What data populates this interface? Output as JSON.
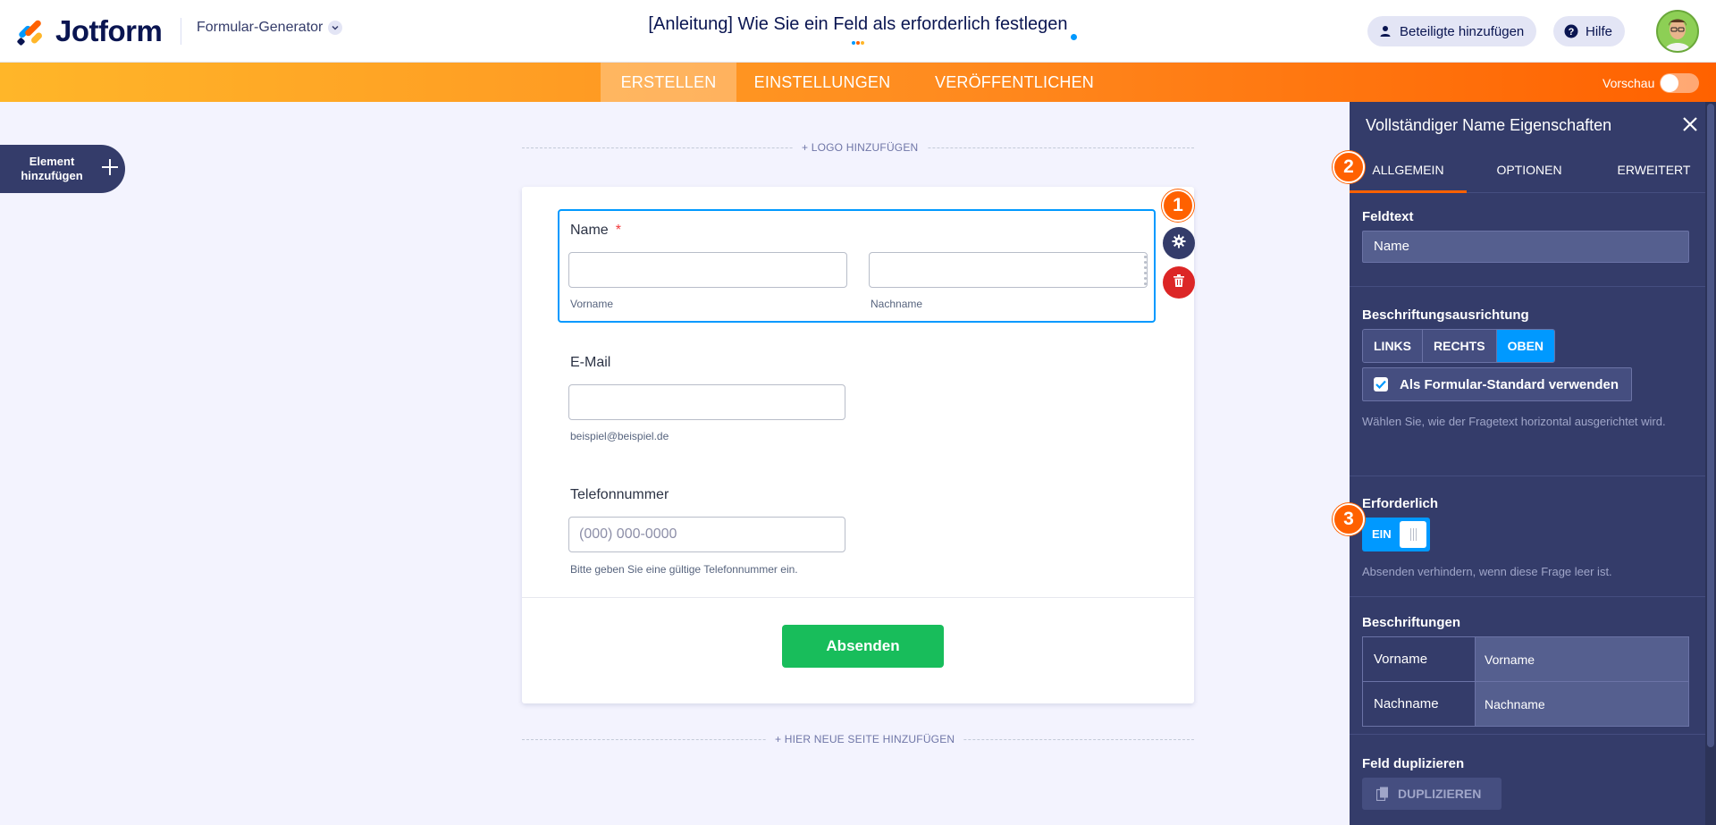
{
  "header": {
    "logo_text": "Jotform",
    "builder_label": "Formular-Generator",
    "form_title": "[Anleitung] Wie Sie ein Feld als erforderlich festlegen",
    "add_participants_label": "Beteiligte hinzufügen",
    "help_label": "Hilfe"
  },
  "nav": {
    "tabs": [
      {
        "label": "ERSTELLEN",
        "active": true
      },
      {
        "label": "EINSTELLUNGEN",
        "active": false
      },
      {
        "label": "VERÖFFENTLICHEN",
        "active": false
      }
    ],
    "preview_label": "Vorschau",
    "preview_on": false
  },
  "canvas": {
    "add_element_label": "Element hinzufügen",
    "add_logo_label": "+ LOGO HINZUFÜGEN",
    "add_page_label": "+ HIER NEUE SEITE HINZUFÜGEN",
    "fields": {
      "name": {
        "label": "Name",
        "required_mark": "*",
        "first_sublabel": "Vorname",
        "last_sublabel": "Nachname",
        "first_value": "",
        "last_value": ""
      },
      "email": {
        "label": "E-Mail",
        "value": "",
        "sublabel": "beispiel@beispiel.de"
      },
      "phone": {
        "label": "Telefonnummer",
        "placeholder": "(000) 000-0000",
        "sublabel": "Bitte geben Sie eine gültige Telefonnummer ein."
      }
    },
    "submit_label": "Absenden",
    "step_badges": [
      "1",
      "2",
      "3"
    ]
  },
  "panel": {
    "title": "Vollständiger Name Eigenschaften",
    "tabs": [
      {
        "label": "ALLGEMEIN",
        "active": true
      },
      {
        "label": "OPTIONEN",
        "active": false
      },
      {
        "label": "ERWEITERT",
        "active": false
      }
    ],
    "field_text_label": "Feldtext",
    "field_text_value": "Name",
    "alignment_label": "Beschriftungsausrichtung",
    "alignment_options": [
      {
        "label": "LINKS",
        "selected": false
      },
      {
        "label": "RECHTS",
        "selected": false
      },
      {
        "label": "OBEN",
        "selected": true
      }
    ],
    "default_checkbox_label": "Als Formular-Standard verwenden",
    "default_checked": true,
    "alignment_hint": "Wählen Sie, wie der Fragetext horizontal ausgerichtet wird.",
    "required_label": "Erforderlich",
    "required_toggle_label": "EIN",
    "required_on": true,
    "required_hint": "Absenden verhindern, wenn diese Frage leer ist.",
    "captions_label": "Beschriftungen",
    "captions": [
      {
        "key": "Vorname",
        "value": "Vorname"
      },
      {
        "key": "Nachname",
        "value": "Nachname"
      }
    ],
    "duplicate_label": "Feld duplizieren",
    "duplicate_button_label": "DUPLIZIEREN"
  },
  "colors": {
    "brand_orange": "#ff6100",
    "accent_blue": "#0099ff",
    "panel_bg": "#343c6a",
    "submit_green": "#18bd5b",
    "delete_red": "#dc2626"
  },
  "icons": [
    "jotform-logo-icon",
    "chevron-down-icon",
    "user-icon",
    "help-icon",
    "avatar",
    "plus-icon",
    "gear-icon",
    "trash-icon",
    "drag-handle-icon",
    "close-icon",
    "check-icon",
    "copy-icon"
  ]
}
